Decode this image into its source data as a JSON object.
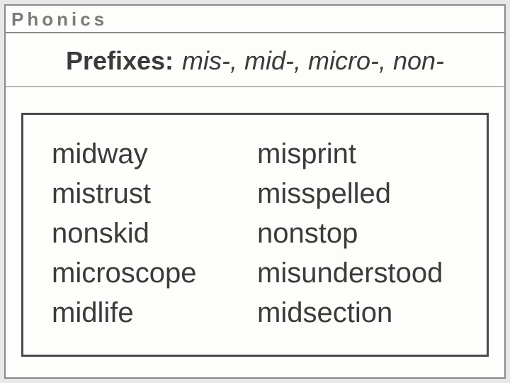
{
  "header": {
    "label": "Phonics"
  },
  "title": {
    "bold": "Prefixes:",
    "italic": "mis-, mid-, micro-, non-"
  },
  "columns": {
    "left": [
      "midway",
      "mistrust",
      "nonskid",
      "microscope",
      "midlife"
    ],
    "right": [
      "misprint",
      "misspelled",
      "nonstop",
      "misunderstood",
      "midsection"
    ]
  }
}
